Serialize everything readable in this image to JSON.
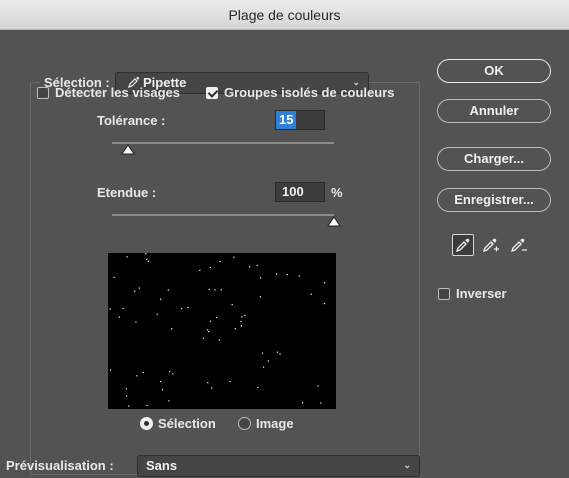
{
  "window": {
    "title": "Plage de couleurs"
  },
  "selection": {
    "label": "Sélection :",
    "value": "Pipette"
  },
  "options": {
    "detect_faces": {
      "label": "Détecter les visages",
      "checked": false
    },
    "localized_clusters": {
      "label": "Groupes isolés de couleurs",
      "checked": true
    }
  },
  "tolerance": {
    "label": "Tolérance :",
    "value": "15",
    "fraction": 0.07
  },
  "range": {
    "label": "Etendue :",
    "value": "100",
    "unit": "%",
    "fraction": 1.0
  },
  "preview_mode": {
    "selection": {
      "label": "Sélection",
      "selected": true
    },
    "image": {
      "label": "Image",
      "selected": false
    }
  },
  "buttons": {
    "ok": "OK",
    "cancel": "Annuler",
    "load": "Charger...",
    "save": "Enregistrer..."
  },
  "eyedroppers": [
    "eyedropper-icon",
    "eyedropper-plus-icon",
    "eyedropper-minus-icon"
  ],
  "invert": {
    "label": "Inverser",
    "checked": false
  },
  "preview": {
    "label": "Prévisualisation :",
    "value": "Sans"
  }
}
